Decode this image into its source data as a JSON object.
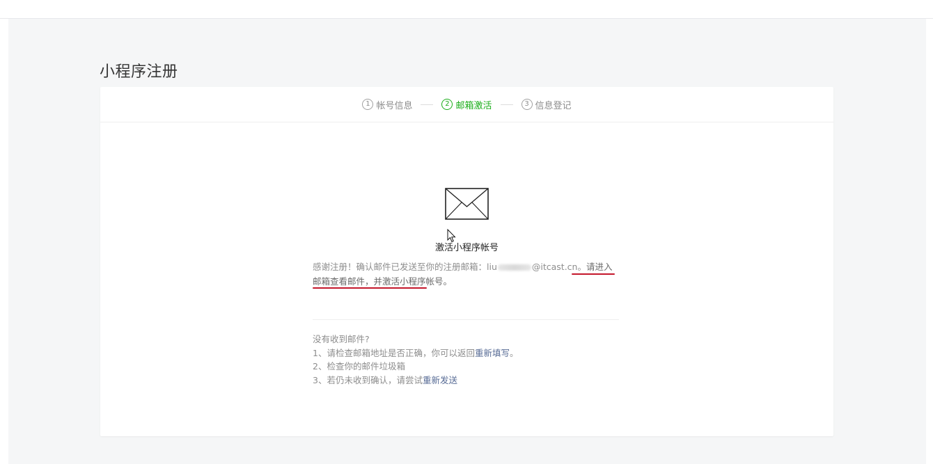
{
  "page": {
    "title": "小程序注册"
  },
  "steps": [
    {
      "num": "1",
      "label": "帐号信息",
      "active": false
    },
    {
      "num": "2",
      "label": "邮箱激活",
      "active": true
    },
    {
      "num": "3",
      "label": "信息登记",
      "active": false
    }
  ],
  "activation": {
    "icon": "envelope-icon",
    "title": "激活小程序帐号",
    "message_prefix": "感谢注册！确认邮件已发送至你的注册邮箱：",
    "email_start": "liu",
    "email_domain": "@itcast.cn。",
    "message_highlight": "请进入邮箱查看邮件，并激活小程序帐号。"
  },
  "help": {
    "heading": "没有收到邮件?",
    "item1_prefix": "1、请检查邮箱地址是否正确，你可以返回",
    "item1_link": "重新填写",
    "item1_suffix": "。",
    "item2": "2、检查你的邮件垃圾箱",
    "item3_prefix": "3、若仍未收到确认，请尝试",
    "item3_link": "重新发送"
  },
  "colors": {
    "active_step": "#1aad19",
    "link": "#576b95",
    "underline_annotation": "#c4162b"
  }
}
